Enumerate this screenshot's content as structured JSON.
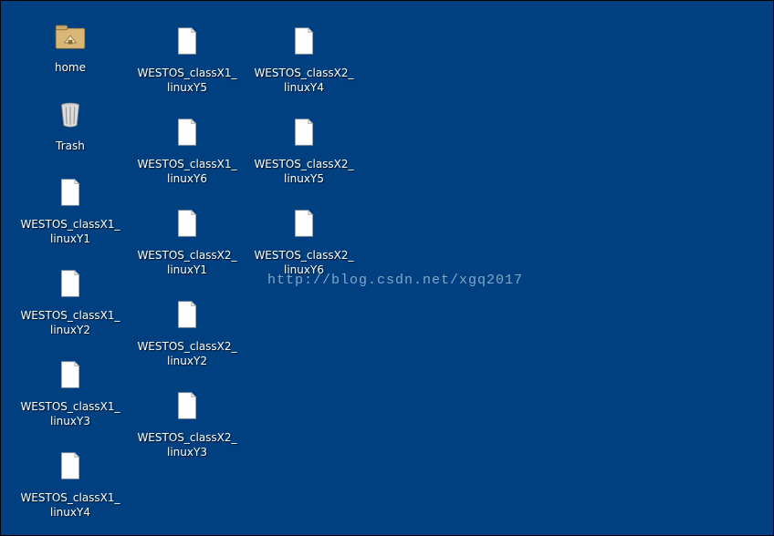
{
  "icons": {
    "home": {
      "label": "home"
    },
    "trash": {
      "label": "Trash"
    },
    "x1y1": {
      "label": "WESTOS_classX1_\nlinuxY1"
    },
    "x1y2": {
      "label": "WESTOS_classX1_\nlinuxY2"
    },
    "x1y3": {
      "label": "WESTOS_classX1_\nlinuxY3"
    },
    "x1y4": {
      "label": "WESTOS_classX1_\nlinuxY4"
    },
    "x1y5": {
      "label": "WESTOS_classX1_\nlinuxY5"
    },
    "x1y6": {
      "label": "WESTOS_classX1_\nlinuxY6"
    },
    "x2y1": {
      "label": "WESTOS_classX2_\nlinuxY1"
    },
    "x2y2": {
      "label": "WESTOS_classX2_\nlinuxY2"
    },
    "x2y3": {
      "label": "WESTOS_classX2_\nlinuxY3"
    },
    "x2y4": {
      "label": "WESTOS_classX2_\nlinuxY4"
    },
    "x2y5": {
      "label": "WESTOS_classX2_\nlinuxY5"
    },
    "x2y6": {
      "label": "WESTOS_classX2_\nlinuxY6"
    }
  },
  "watermark": "http://blog.csdn.net/xgq2017"
}
